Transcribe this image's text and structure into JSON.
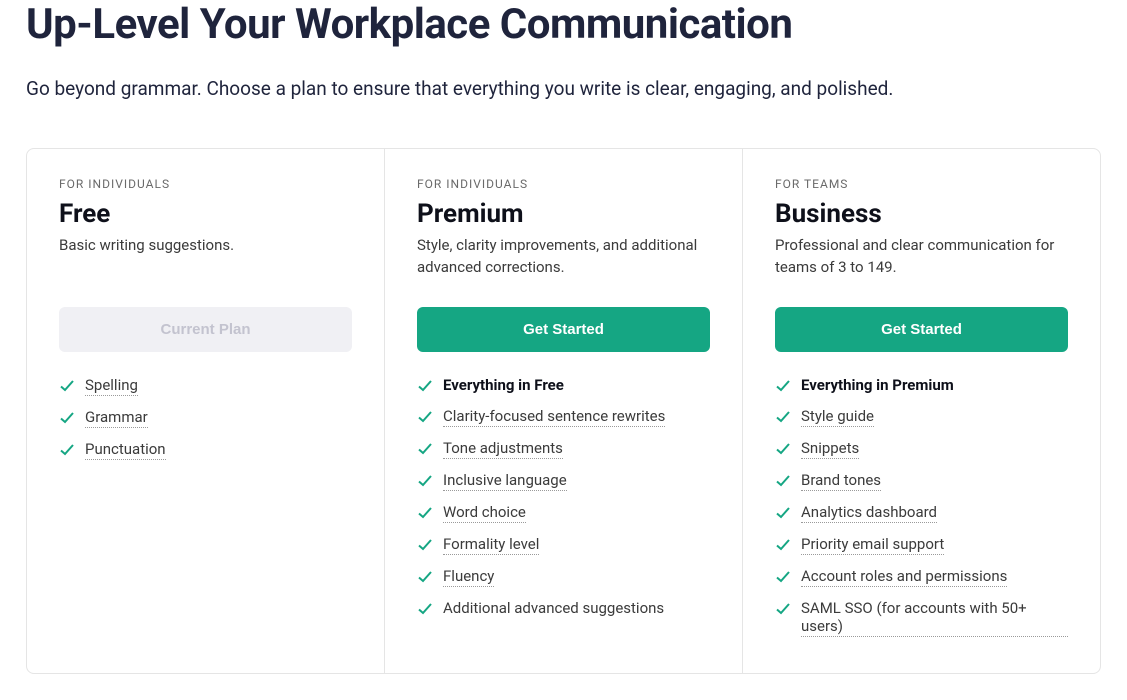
{
  "header": {
    "title": "Up-Level Your Workplace Communication",
    "subtitle": "Go beyond grammar. Choose a plan to ensure that everything you write is clear, engaging, and polished."
  },
  "colors": {
    "accent": "#15a683",
    "check": "#15a683"
  },
  "plans": [
    {
      "audience": "FOR INDIVIDUALS",
      "name": "Free",
      "description": "Basic writing suggestions.",
      "cta": {
        "label": "Current Plan",
        "style": "disabled"
      },
      "features": [
        {
          "label": "Spelling",
          "style": "dotted"
        },
        {
          "label": "Grammar",
          "style": "dotted"
        },
        {
          "label": "Punctuation",
          "style": "dotted"
        }
      ]
    },
    {
      "audience": "FOR INDIVIDUALS",
      "name": "Premium",
      "description": "Style, clarity improvements, and additional advanced corrections.",
      "cta": {
        "label": "Get Started",
        "style": "primary"
      },
      "features": [
        {
          "label": "Everything in Free",
          "style": "bold"
        },
        {
          "label": "Clarity-focused sentence rewrites",
          "style": "dotted"
        },
        {
          "label": "Tone adjustments",
          "style": "dotted"
        },
        {
          "label": "Inclusive language",
          "style": "dotted"
        },
        {
          "label": "Word choice",
          "style": "dotted"
        },
        {
          "label": "Formality level",
          "style": "dotted"
        },
        {
          "label": "Fluency",
          "style": "dotted"
        },
        {
          "label": "Additional advanced suggestions",
          "style": "plain"
        }
      ]
    },
    {
      "audience": "FOR TEAMS",
      "name": "Business",
      "description": "Professional and clear communication for teams of 3 to 149.",
      "cta": {
        "label": "Get Started",
        "style": "primary"
      },
      "features": [
        {
          "label": "Everything in Premium",
          "style": "bold"
        },
        {
          "label": "Style guide",
          "style": "dotted"
        },
        {
          "label": "Snippets",
          "style": "dotted"
        },
        {
          "label": "Brand tones",
          "style": "dotted"
        },
        {
          "label": "Analytics dashboard",
          "style": "dotted"
        },
        {
          "label": "Priority email support",
          "style": "dotted"
        },
        {
          "label": "Account roles and permissions",
          "style": "dotted"
        },
        {
          "label": "SAML SSO (for accounts with 50+ users)",
          "style": "dotted"
        }
      ]
    }
  ]
}
